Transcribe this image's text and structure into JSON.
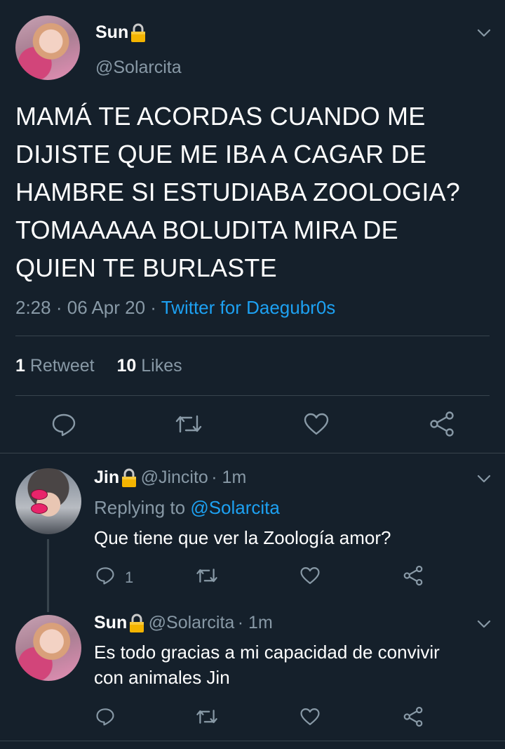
{
  "colors": {
    "background": "#15202b",
    "text": "#ffffff",
    "muted": "#8899a6",
    "link": "#1da1f2",
    "divider": "#38444d"
  },
  "main_tweet": {
    "name": "Sun",
    "handle": "@Solarcita",
    "text_lines": [
      "MAMÁ TE ACORDAS CUANDO ME",
      "DIJISTE QUE ME IBA A CAGAR DE",
      "HAMBRE SI ESTUDIABA ZOOLOGIA?",
      "TOMAAAAA BOLUDITA MIRA DE",
      "QUIEN TE BURLASTE"
    ],
    "time": "2:28",
    "date": "06 Apr 20",
    "sep": "·",
    "source": "Twitter for Daegubr0s",
    "retweets_count": "1",
    "retweets_label": "Retweet",
    "likes_count": "10",
    "likes_label": "Likes"
  },
  "replies": [
    {
      "name": "Jin",
      "handle": "@Jincito",
      "time": "· 1m",
      "replying_label": "Replying to",
      "replying_to": "@Solarcita",
      "text_lines": [
        "Que tiene que ver la Zoología amor?"
      ],
      "reply_count": "1"
    },
    {
      "name": "Sun",
      "handle": "@Solarcita",
      "time": "· 1m",
      "text_lines": [
        "Es todo gracias a mi capacidad de convivir",
        "con animales Jin"
      ],
      "reply_count": ""
    }
  ],
  "icons": [
    "lock-icon",
    "chevron-down-icon",
    "reply-icon",
    "retweet-icon",
    "like-icon",
    "share-icon"
  ]
}
